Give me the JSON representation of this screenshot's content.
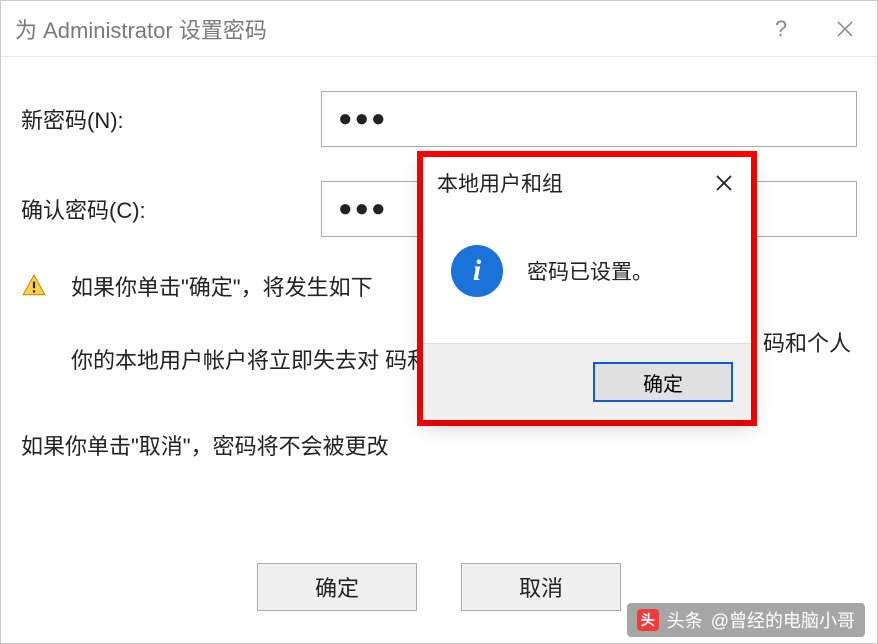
{
  "window": {
    "title": "为 Administrator 设置密码",
    "help_tooltip": "?",
    "close_tooltip": "×"
  },
  "form": {
    "new_password_label": "新密码(N):",
    "new_password_value": "●●●",
    "confirm_password_label": "确认密码(C):",
    "confirm_password_value": "●●●"
  },
  "warning": {
    "line1": "如果你单击\"确定\"，将发生如下",
    "line2": "你的本地用户帐户将立即失去对                                             码和个人安全证书的访问权。",
    "line3": "如果你单击\"取消\"，密码将不会被更改"
  },
  "buttons": {
    "ok": "确定",
    "cancel": "取消"
  },
  "popup": {
    "title": "本地用户和组",
    "message": "密码已设置。",
    "ok": "确定"
  },
  "trail": "码和个人",
  "watermark": {
    "prefix": "头条",
    "text": "@曾经的电脑小哥"
  }
}
